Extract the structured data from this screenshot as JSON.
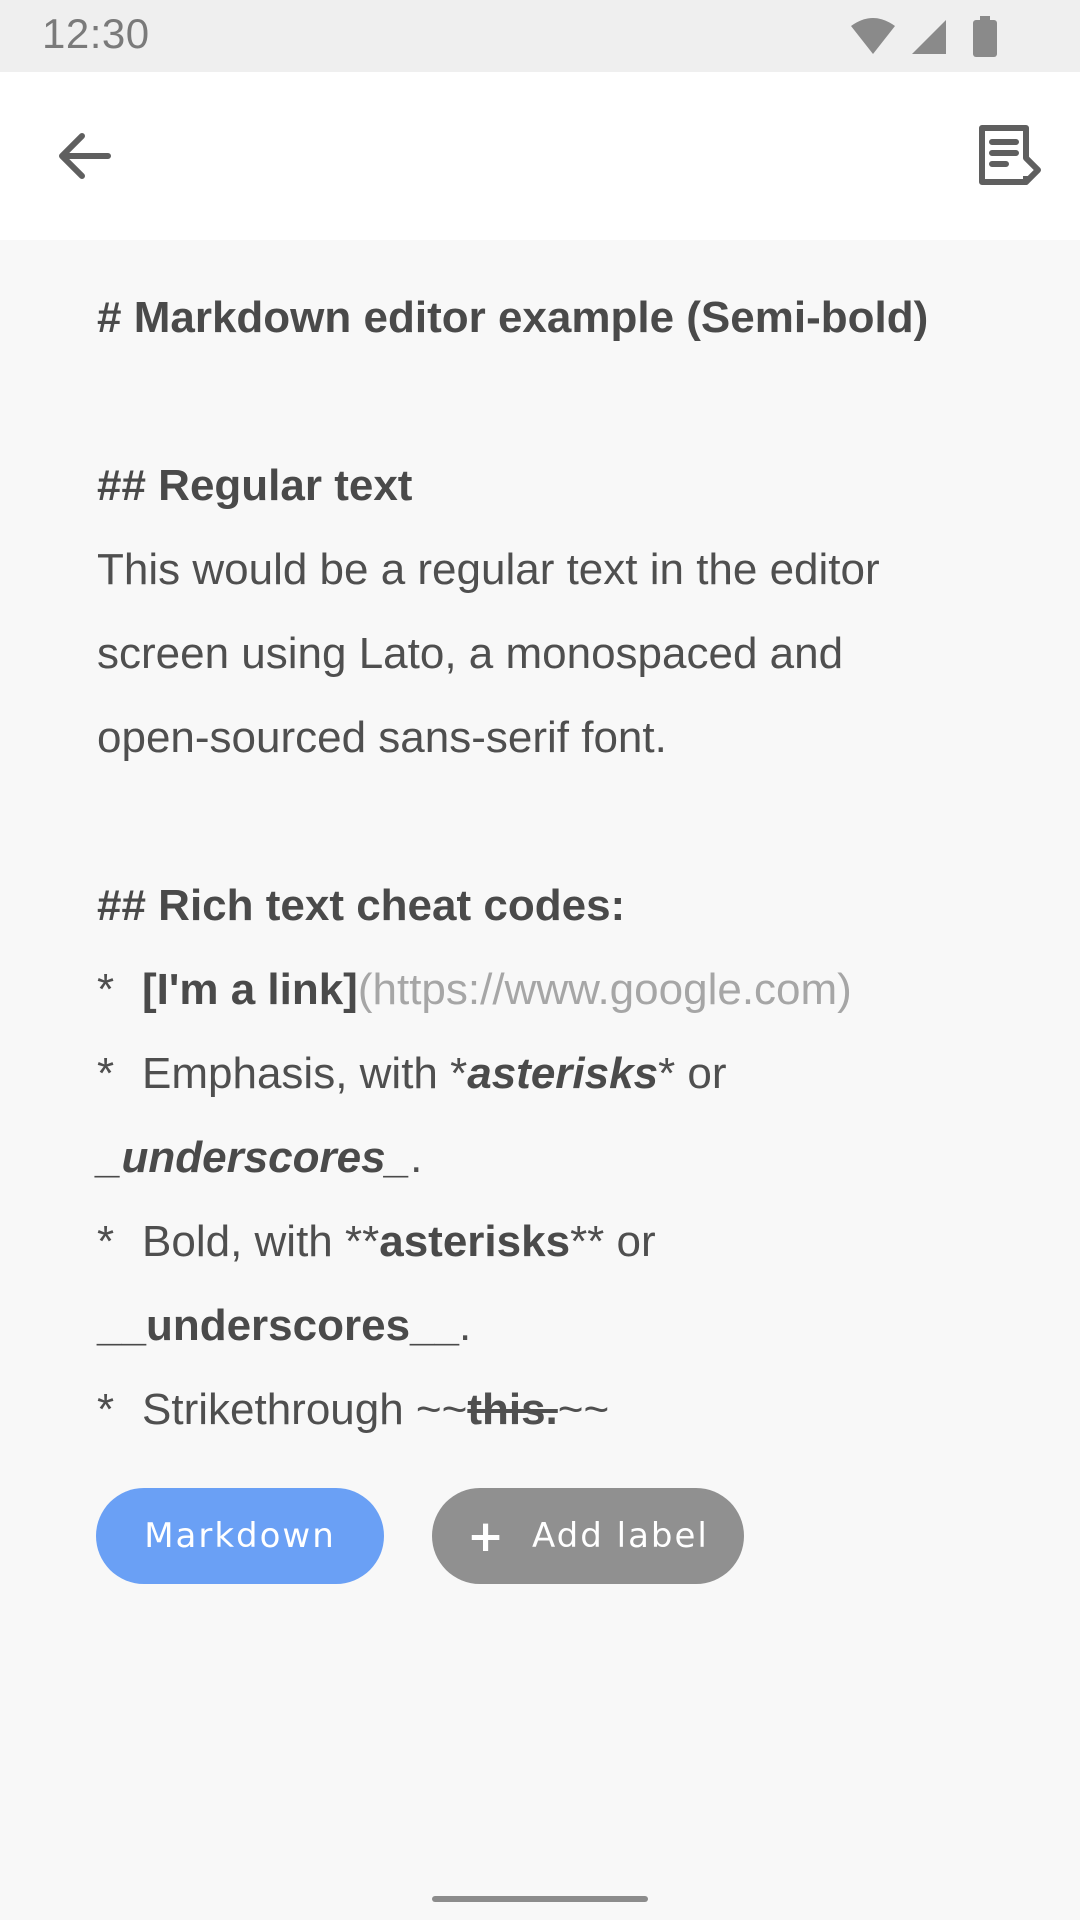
{
  "status_bar": {
    "time": "12:30",
    "icons": [
      "wifi-icon",
      "cell-signal-icon",
      "battery-icon"
    ]
  },
  "app_bar": {
    "back_icon": "arrow-left-icon",
    "preview_icon": "document-preview-icon"
  },
  "editor": {
    "heading1": "# Markdown editor example (Semi-bold)",
    "heading2_regular": "## Regular text",
    "regular_line1": "This would be a regular text in the editor",
    "regular_line2": "screen using Lato, a monospaced and",
    "regular_line3": "open-sourced sans-serif font.",
    "heading2_rich": "## Rich text cheat codes:",
    "bullet": "*",
    "link_text": "[I'm a link]",
    "link_url": "(https://www.google.com)",
    "emph_prefix": "Emphasis, with *",
    "emph_word": "asterisks",
    "emph_suffix": "* or",
    "emph_underscores": "_underscores_",
    "period": ".",
    "bold_prefix": "Bold, with **",
    "bold_word": "asterisks",
    "bold_suffix": "** or",
    "bold_underscores": "__underscores__",
    "strike_prefix": "Strikethrough ~~",
    "strike_word": "this.",
    "strike_suffix": "~~"
  },
  "chips": {
    "markdown_label": "Markdown",
    "add_label": "Add label"
  },
  "colors": {
    "markdown_chip": "#6aa0f5",
    "add_label_chip": "#909090",
    "background": "#f8f8f8"
  }
}
